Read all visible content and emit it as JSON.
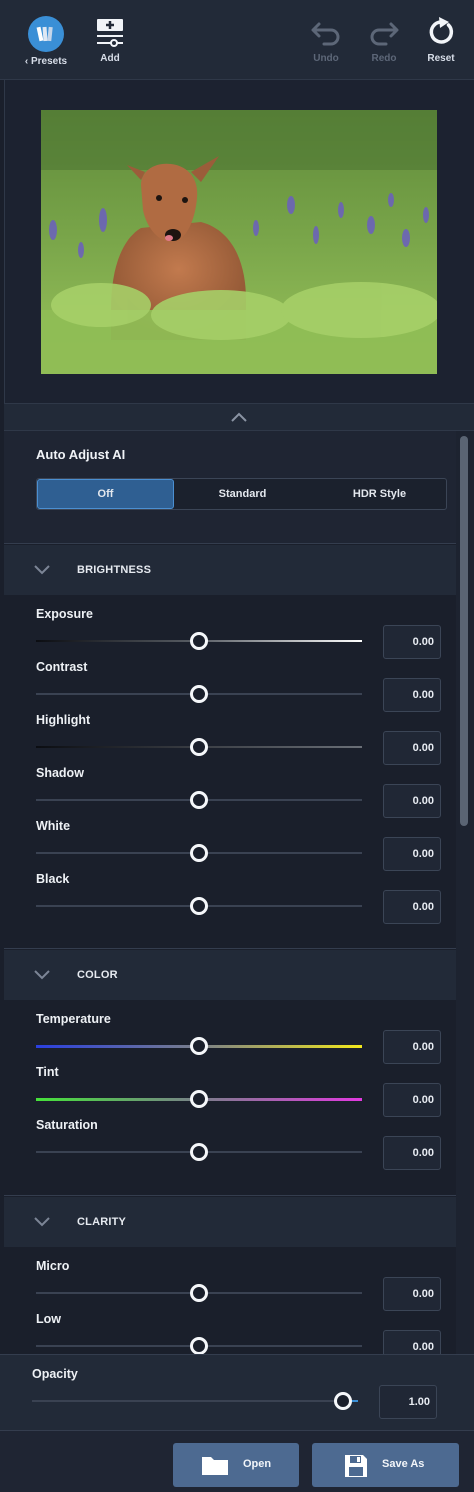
{
  "toolbar": {
    "presets_label": "Presets",
    "add_label": "Add",
    "undo_label": "Undo",
    "redo_label": "Redo",
    "reset_label": "Reset"
  },
  "auto_adjust": {
    "title": "Auto Adjust AI",
    "options": [
      "Off",
      "Standard",
      "HDR Style"
    ],
    "selected": "Off"
  },
  "sections": {
    "brightness": {
      "title": "BRIGHTNESS",
      "sliders": [
        {
          "label": "Exposure",
          "value": "0.00"
        },
        {
          "label": "Contrast",
          "value": "0.00"
        },
        {
          "label": "Highlight",
          "value": "0.00"
        },
        {
          "label": "Shadow",
          "value": "0.00"
        },
        {
          "label": "White",
          "value": "0.00"
        },
        {
          "label": "Black",
          "value": "0.00"
        }
      ]
    },
    "color": {
      "title": "COLOR",
      "sliders": [
        {
          "label": "Temperature",
          "value": "0.00"
        },
        {
          "label": "Tint",
          "value": "0.00"
        },
        {
          "label": "Saturation",
          "value": "0.00"
        }
      ]
    },
    "clarity": {
      "title": "CLARITY",
      "sliders": [
        {
          "label": "Micro",
          "value": "0.00"
        },
        {
          "label": "Low",
          "value": "0.00"
        }
      ]
    }
  },
  "opacity": {
    "label": "Opacity",
    "value": "1.00",
    "level": 1.0
  },
  "actions": {
    "open_label": "Open",
    "save_as_label": "Save As"
  },
  "colors": {
    "accent": "#3a8fd6",
    "button": "#4d6a91",
    "background": "#1a1f2b"
  }
}
